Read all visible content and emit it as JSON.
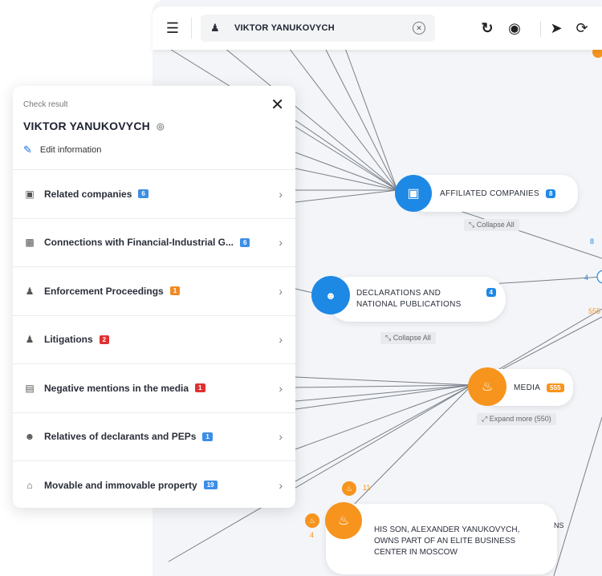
{
  "topbar": {
    "menu_icon": "menu-icon",
    "search_icon": "person-search-icon",
    "search_value": "VIKTOR YANUKOVYCH",
    "clear_icon": "clear-icon",
    "refresh_icon": "refresh-icon",
    "locate_icon": "target-icon",
    "pointer_icon": "cursor-icon",
    "lasso_icon": "lasso-icon"
  },
  "panel": {
    "subtitle": "Check result",
    "title": "VIKTOR YANUKOVYCH",
    "edit_label": "Edit information",
    "items": [
      {
        "label": "Related companies",
        "badge": "6",
        "color": "#3d8ee6",
        "icon": "building-icon"
      },
      {
        "label": "Connections with Financial-Industrial G...",
        "badge": "6",
        "color": "#3d8ee6",
        "icon": "industry-icon"
      },
      {
        "label": "Enforcement Proceedings",
        "badge": "1",
        "color": "#f08a24",
        "icon": "person-alert-icon"
      },
      {
        "label": "Litigations",
        "badge": "2",
        "color": "#e03131",
        "icon": "person-alert-icon"
      },
      {
        "label": "Negative mentions in the media",
        "badge": "1",
        "color": "#e03131",
        "icon": "newspaper-icon"
      },
      {
        "label": "Relatives of declarants and PEPs",
        "badge": "1",
        "color": "#3d8ee6",
        "icon": "group-icon"
      },
      {
        "label": "Movable and immovable property",
        "badge": "19",
        "color": "#3d8ee6",
        "icon": "home-icon"
      }
    ]
  },
  "graph": {
    "affiliated": {
      "label": "AFFILIATED COMPANIES",
      "badge": "8",
      "collapse": "Collapse All"
    },
    "declarations": {
      "label1": "DECLARATIONS AND",
      "label2": "NATIONAL PUBLICATIONS",
      "badge": "4",
      "collapse": "Collapse All"
    },
    "media": {
      "label": "MEDIA",
      "badge": "555",
      "expand": "Expand more (550)"
    },
    "news": {
      "line1": "HIS SON, ALEXANDER YANUKOVYCH,",
      "line2": "OWNS PART OF AN ELITE BUSINESS",
      "line3": "CENTER IN MOSCOW",
      "count_top": "11",
      "count_left": "4",
      "cut_text": "NS"
    },
    "edge_labels": {
      "e8": "8",
      "e4": "4",
      "e555": "555"
    },
    "colors": {
      "blue": "#1e88e5",
      "orange": "#f7941d",
      "red": "#e03131"
    }
  }
}
